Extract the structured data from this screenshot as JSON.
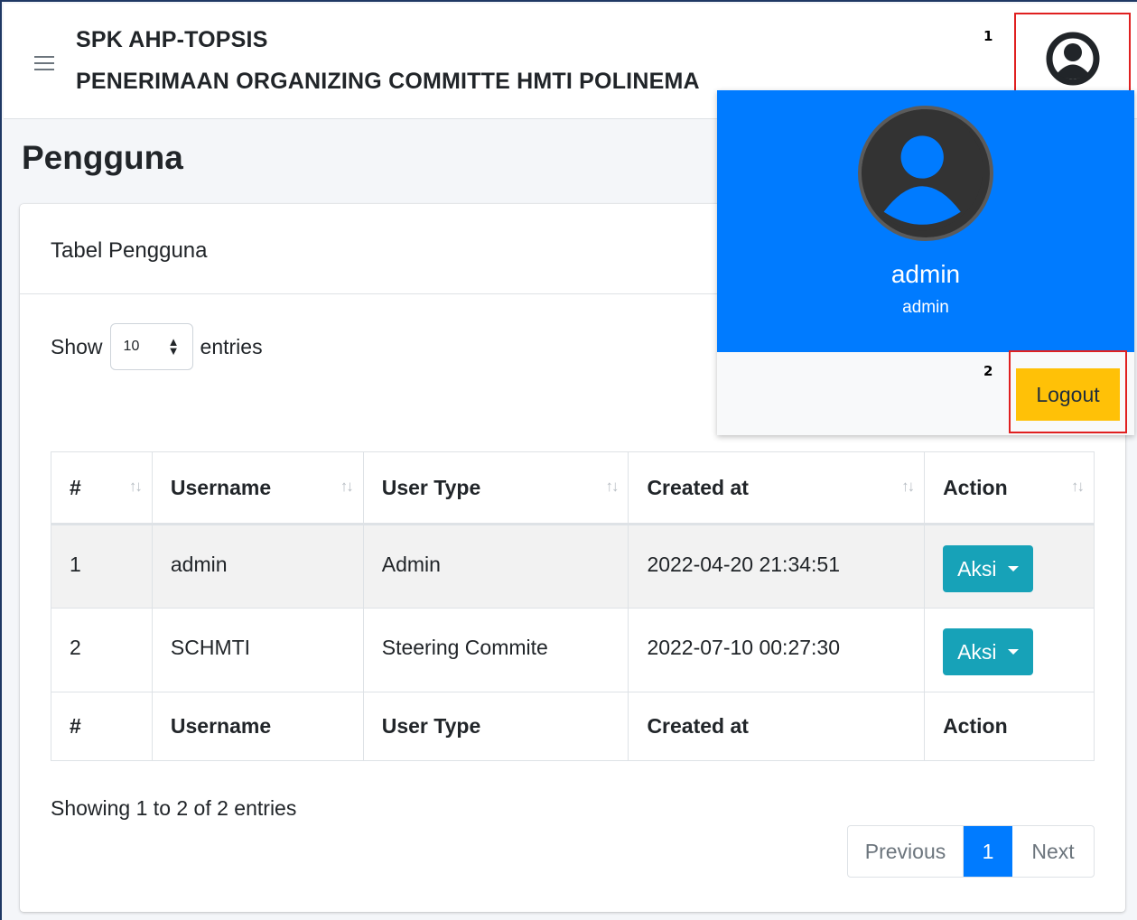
{
  "header": {
    "brand_line1": "SPK AHP-TOPSIS",
    "brand_line2": "PENERIMAAN ORGANIZING COMMITTE HMTI POLINEMA",
    "annotation_1": "1",
    "annotation_2": "2"
  },
  "page": {
    "title": "Pengguna"
  },
  "card": {
    "title": "Tabel Pengguna",
    "show_label": "Show",
    "entries_value": "10",
    "entries_label": "entries",
    "info": "Showing 1 to 2 of 2 entries"
  },
  "table": {
    "columns": [
      "#",
      "Username",
      "User Type",
      "Created at",
      "Action"
    ],
    "rows": [
      {
        "num": "1",
        "username": "admin",
        "user_type": "Admin",
        "created_at": "2022-04-20 21:34:51",
        "action": "Aksi"
      },
      {
        "num": "2",
        "username": "SCHMTI",
        "user_type": "Steering Commite",
        "created_at": "2022-07-10 00:27:30",
        "action": "Aksi"
      }
    ]
  },
  "pagination": {
    "previous": "Previous",
    "current": "1",
    "next": "Next"
  },
  "user_dropdown": {
    "name": "admin",
    "role": "admin",
    "logout_label": "Logout"
  },
  "colors": {
    "primary": "#007bff",
    "info": "#17a2b8",
    "warning": "#ffc107",
    "annotation_box": "#e02020"
  },
  "icons": {
    "menu": "hamburger-icon",
    "user": "user-circle-icon",
    "sort": "sort-icon",
    "dropdown": "caret-down-icon"
  }
}
